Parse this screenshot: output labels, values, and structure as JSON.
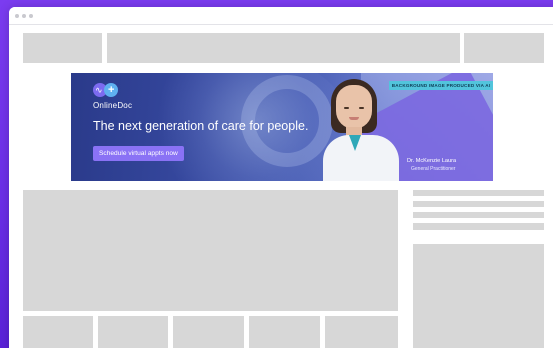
{
  "window": {
    "controls": [
      "close",
      "minimize",
      "maximize"
    ]
  },
  "banner": {
    "brand": "OnlineDoc",
    "headline": "The next generation of care for people.",
    "cta_label": "Schedule virtual appts now",
    "disclaimer": "BACKGROUND IMAGE PRODUCED VIA AI",
    "doctor_name": "Dr. McKenzie Laura",
    "doctor_title": "General Practitioner",
    "logo_glyph": "+"
  },
  "colors": {
    "page_background": "#6a2ee6",
    "cta": "#8a72f5",
    "disclaimer": "#52c4dc",
    "placeholder": "#d7d7d7"
  }
}
